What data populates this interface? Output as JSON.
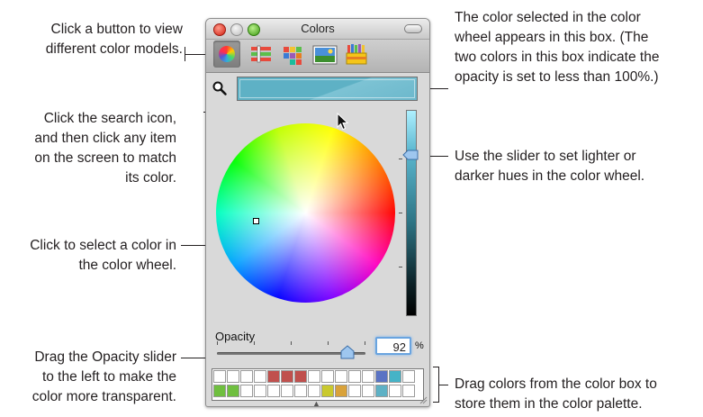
{
  "window": {
    "title": "Colors",
    "opacity_label": "Opacity",
    "opacity_value": "92",
    "opacity_unit": "%",
    "opacity_fraction": 0.92,
    "brightness_fraction": 0.8,
    "selected_color": "#5eb1c5"
  },
  "toolbar": {
    "buttons": [
      "color-wheel",
      "color-sliders",
      "color-palettes",
      "image-palettes",
      "crayons"
    ]
  },
  "callouts": {
    "models": "Click a button to view\ndifferent color models.",
    "search": "Click the search icon,\nand then click any item\non the screen to match\nits color.",
    "wheel": "Click to select a color in\nthe color wheel.",
    "opacity": "Drag the Opacity slider\nto the left to make the\ncolor more transparent.",
    "swatch": "The color selected in the color\nwheel appears in this box. (The\ntwo colors in this box indicate the\nopacity is set to less than 100%.)",
    "slider": "Use the slider to set lighter or\ndarker hues in the color wheel.",
    "palette": "Drag colors from the color box to\nstore them in the color palette."
  },
  "palette": {
    "row1": [
      "#ffffff",
      "#ffffff",
      "#ffffff",
      "#ffffff",
      "#c0504d",
      "#c0504d",
      "#c0504d",
      "#ffffff",
      "#ffffff",
      "#ffffff",
      "#ffffff",
      "#ffffff",
      "#5a73c4",
      "#45b3c7",
      "#ffffff"
    ],
    "row2": [
      "#6fbf3f",
      "#6fbf3f",
      "#ffffff",
      "#ffffff",
      "#ffffff",
      "#ffffff",
      "#ffffff",
      "#ffffff",
      "#c9c92e",
      "#d9a23a",
      "#ffffff",
      "#ffffff",
      "#5eb1c5",
      "#ffffff",
      "#ffffff"
    ]
  }
}
